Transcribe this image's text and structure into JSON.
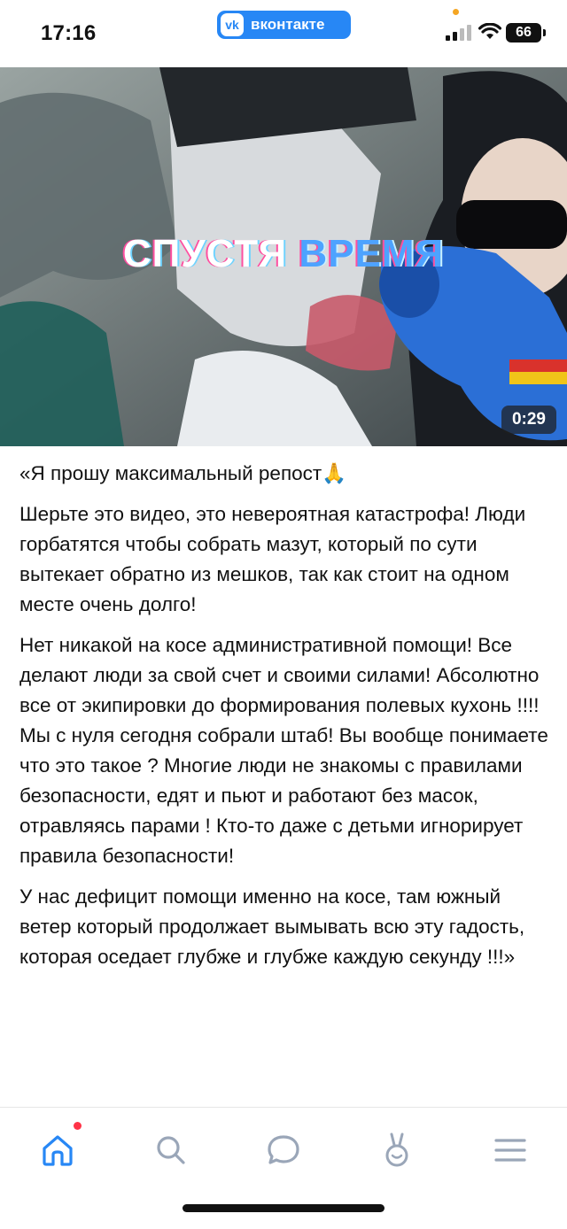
{
  "status_bar": {
    "time": "17:16",
    "app_badge": "вконтакте",
    "app_logo": "vk",
    "battery": "66",
    "icons": [
      "signal-icon",
      "wifi-icon",
      "battery-icon"
    ]
  },
  "video": {
    "overlay_word_1": "СПУСТЯ",
    "overlay_word_2": "ВРЕМЯ",
    "duration": "0:29"
  },
  "post": {
    "paragraphs": [
      "«Я прошу максимальный репост",
      "Шерьте это видео, это невероятная катастрофа! Люди горбатятся чтобы собрать мазут, который по сути вытекает обратно из мешков, так как стоит на одном месте очень долго!",
      "Нет никакой на косе административной помощи! Все делают люди за свой счет и своими силами! Абсолютно все от экипировки до формирования полевых кухонь !!!! Мы с нуля сегодня собрали штаб! Вы вообще понимаете что это такое ? Многие люди не знакомы с правилами безопасности, едят и пьют и работают без масок, отравляясь парами ! Кто-то даже с детьми игнорирует правила безопасности!",
      "У нас дефицит помощи именно на косе, там южный ветер который продолжает вымывать всю эту гадость, которая оседает глубже и глубже каждую секунду !!!»"
    ],
    "pray_emoji": "🙏"
  },
  "tabbar": {
    "items": [
      "home-icon",
      "search-icon",
      "messages-icon",
      "clips-icon",
      "menu-icon"
    ],
    "accent": "#2787f5",
    "inactive": "#9aa6b8"
  }
}
